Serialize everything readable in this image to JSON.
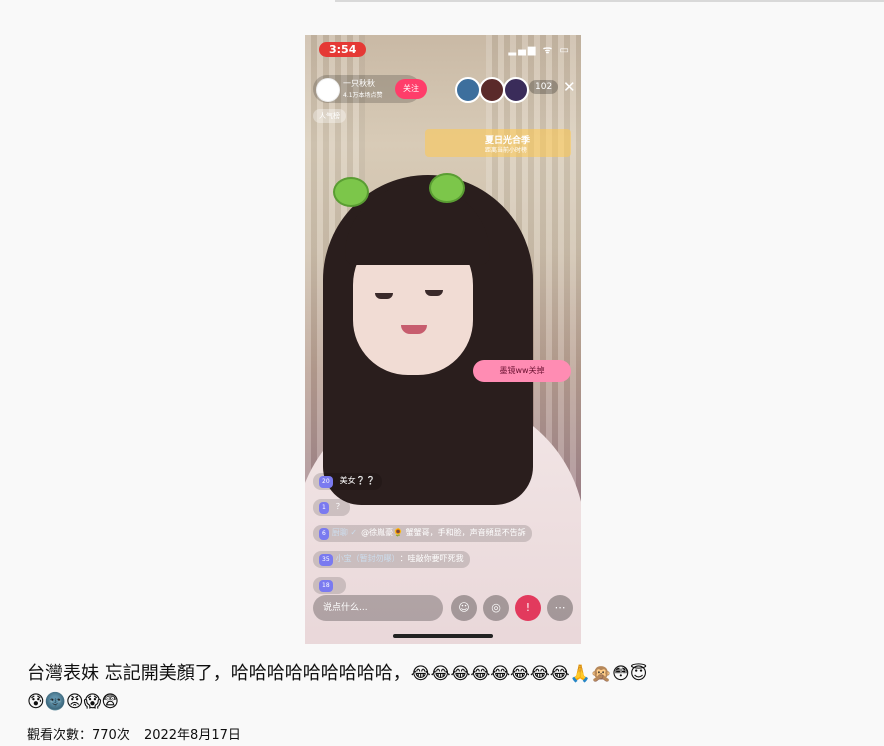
{
  "video": {
    "status_time": "3:54",
    "status_icons": "▂▄▆ ᯤ ▭",
    "host_name": "一只秋秋",
    "host_likes": "4.1万本场点赞",
    "follow_label": "关注",
    "viewer_count": "102",
    "close_glyph": "✕",
    "rank_tag": "人气榜",
    "promo_title": "夏日光合季",
    "promo_sub": "距离当前小时榜",
    "pink_bubble": "墨镜ww关掉",
    "chat": [
      {
        "badge": "20",
        "user": "",
        "text": "美女❔❔"
      },
      {
        "badge": "1",
        "user": "",
        "text": "？"
      },
      {
        "badge": "6",
        "user": "厨聊 ✓",
        "text": "@徐胤豪🌻 蟹蟹哥，手和脸，声音頻显不告訴"
      },
      {
        "badge": "35",
        "user": "小宝（暂封勿曝）",
        "text": "：哇敲你要吓死我"
      },
      {
        "badge": "18",
        "user": "",
        "text": ""
      }
    ],
    "input_placeholder": "说点什么...",
    "btn_icons": [
      "☺",
      "◎",
      "♥",
      "!",
      "⋯"
    ]
  },
  "caption": {
    "text": "台灣表妹 忘記開美顏了，哈哈哈哈哈哈哈哈哈，",
    "emojis_line1": "😂😂😂😂😂😂😂😂🙏🙊😳😇",
    "emojis_line2": "😰🌚😡😱😨"
  },
  "meta": {
    "views": "觀看次數：770次",
    "date": "2022年8月17日"
  }
}
